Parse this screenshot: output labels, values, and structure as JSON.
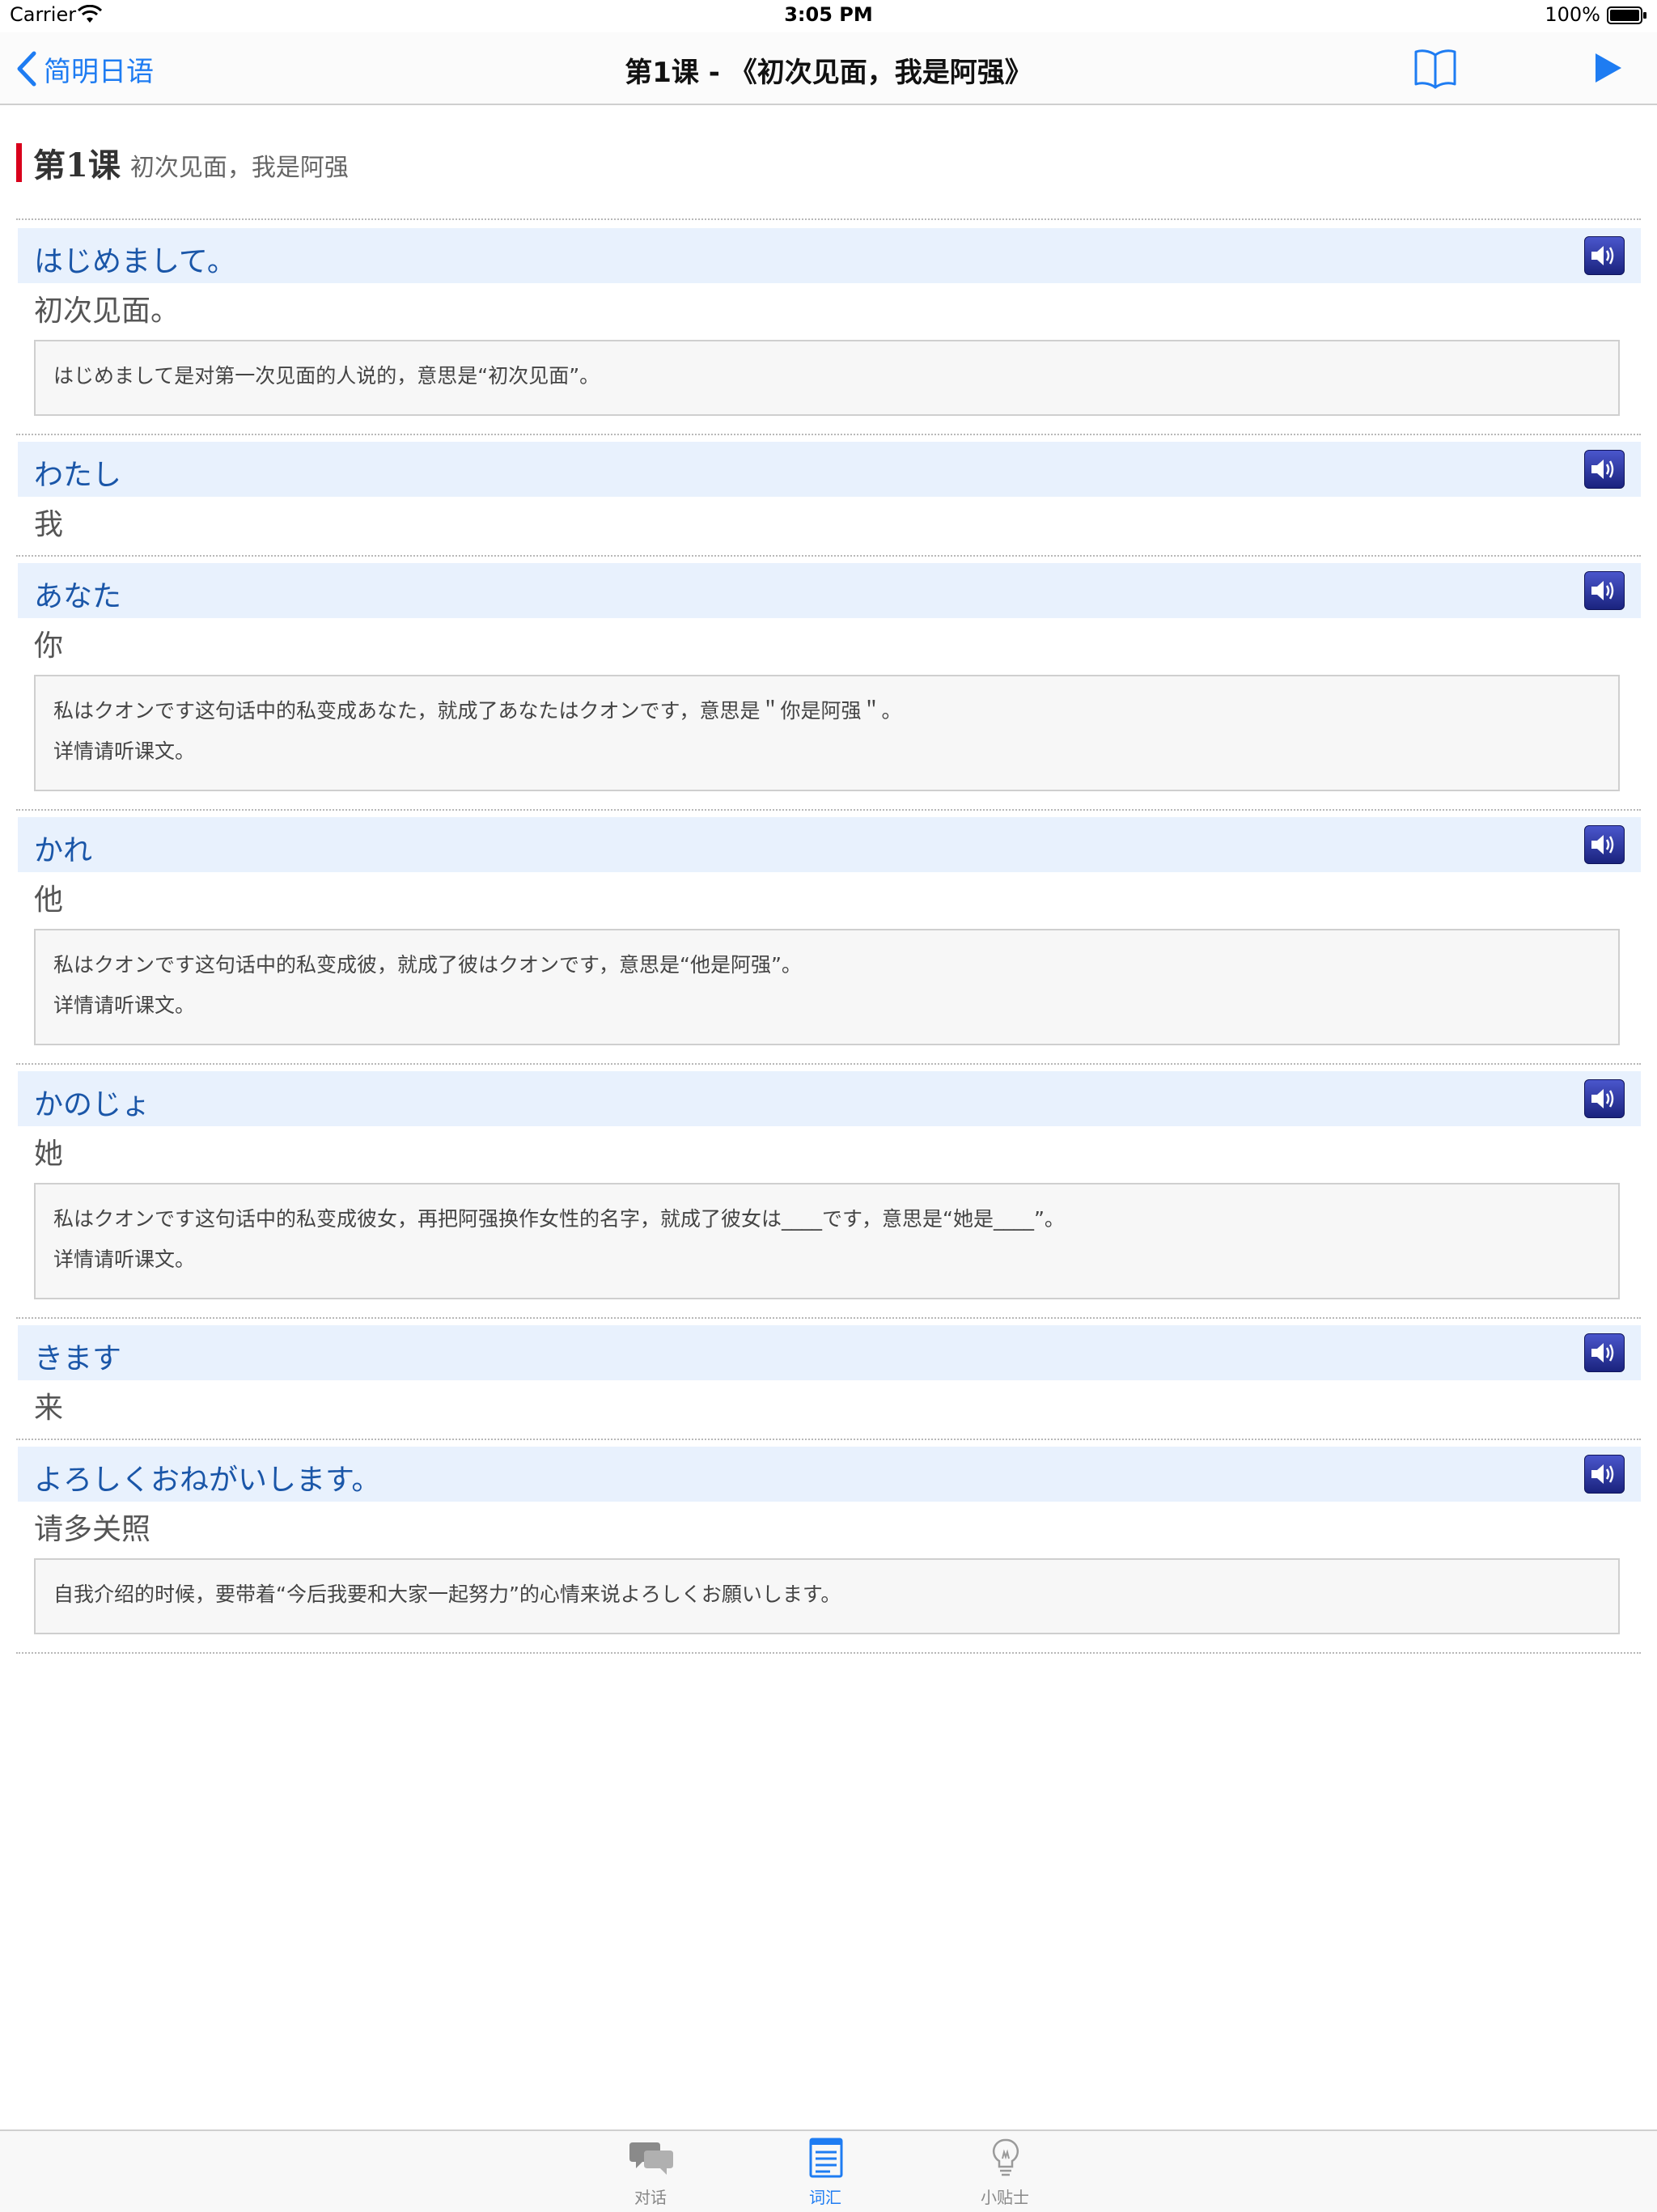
{
  "status_bar": {
    "carrier": "Carrier",
    "time": "3:05 PM",
    "battery": "100%"
  },
  "nav": {
    "back_label": "简明日语",
    "title": "第1课 - 《初次见面，我是阿强》",
    "icons": {
      "back": "chevron-left-icon",
      "book": "book-icon",
      "play": "play-icon"
    },
    "accent_color": "#1e7cf2"
  },
  "lesson": {
    "number": "第1课",
    "subtitle": "初次见面，我是阿强",
    "accent_color": "#d9001b"
  },
  "entries": [
    {
      "japanese": "はじめまして。",
      "meaning": "初次见面。",
      "note": [
        "はじめまして是对第一次见面的人说的，意思是“初次见面”。"
      ]
    },
    {
      "japanese": "わたし",
      "meaning": "我",
      "note": []
    },
    {
      "japanese": "あなた",
      "meaning": "你",
      "note": [
        "私はクオンです这句话中的私变成あなた，就成了あなたはクオンです，意思是＂你是阿强＂。",
        "详情请听课文。"
      ]
    },
    {
      "japanese": "かれ",
      "meaning": "他",
      "note": [
        "私はクオンです这句话中的私变成彼，就成了彼はクオンです，意思是“他是阿强”。",
        "详情请听课文。"
      ]
    },
    {
      "japanese": "かのじょ",
      "meaning": "她",
      "note": [
        "私はクオンです这句话中的私变成彼女，再把阿强换作女性的名字，就成了彼女は____です，意思是“她是____”。",
        "详情请听课文。"
      ]
    },
    {
      "japanese": "きます",
      "meaning": "来",
      "note": []
    },
    {
      "japanese": "よろしくおねがいします。",
      "meaning": "请多关照",
      "note": [
        "自我介绍的时候，要带着“今后我要和大家一起努力”的心情来说よろしくお願いします。"
      ]
    }
  ],
  "tabs": [
    {
      "label": "对话",
      "icon": "chat-bubbles-icon",
      "active": false
    },
    {
      "label": "词汇",
      "icon": "document-icon",
      "active": true
    },
    {
      "label": "小贴士",
      "icon": "lightbulb-icon",
      "active": false
    }
  ]
}
